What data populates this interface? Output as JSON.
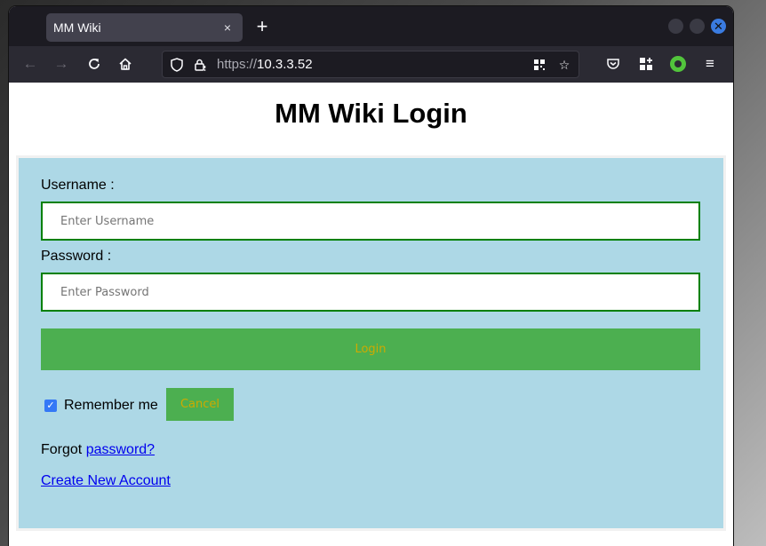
{
  "browser": {
    "tab_title": "MM Wiki",
    "tab_close_icon": "×",
    "new_tab_icon": "+",
    "url_scheme": "https://",
    "url_host": "10.3.3.52"
  },
  "page": {
    "title": "MM Wiki Login",
    "username_label": "Username :",
    "username_placeholder": "Enter Username",
    "password_label": "Password :",
    "password_placeholder": "Enter Password",
    "login_label": "Login",
    "remember_label": "Remember me",
    "remember_checked": true,
    "cancel_label": "Cancel",
    "forgot_prefix": "Forgot ",
    "forgot_link": "password?",
    "create_link": "Create New Account"
  },
  "colors": {
    "form_background": "#add8e6",
    "button_background": "#4caf50",
    "button_text": "#cdaa00",
    "input_border": "#008000",
    "link": "#0000ee"
  }
}
